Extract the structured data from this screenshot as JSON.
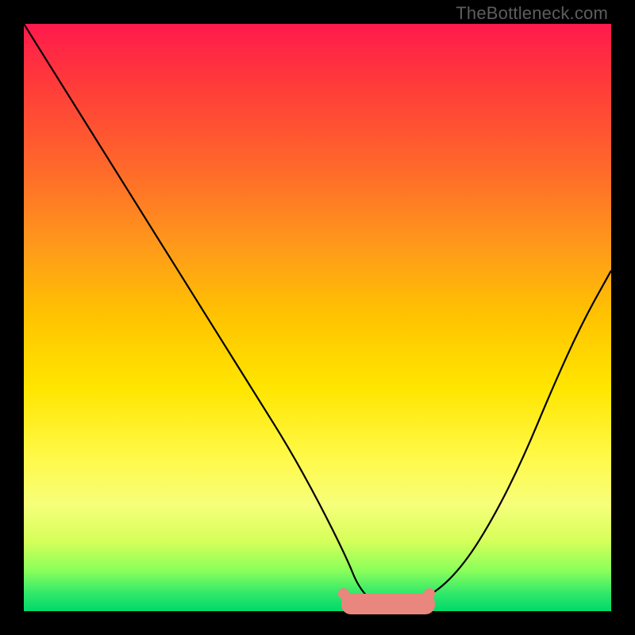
{
  "watermark": "TheBottleneck.com",
  "chart_data": {
    "type": "line",
    "title": "",
    "xlabel": "",
    "ylabel": "",
    "xlim": [
      0,
      100
    ],
    "ylim": [
      0,
      100
    ],
    "grid": false,
    "legend": false,
    "background_gradient": {
      "direction": "vertical",
      "stops": [
        {
          "pos": 0.0,
          "color": "#ff1a4d"
        },
        {
          "pos": 0.5,
          "color": "#ffc400"
        },
        {
          "pos": 0.82,
          "color": "#f6ff7a"
        },
        {
          "pos": 1.0,
          "color": "#00d96a"
        }
      ]
    },
    "series": [
      {
        "name": "bottleneck-curve",
        "color": "#000000",
        "x": [
          0,
          5,
          10,
          15,
          20,
          25,
          30,
          35,
          40,
          45,
          50,
          55,
          57,
          60,
          63,
          65,
          70,
          75,
          80,
          85,
          90,
          95,
          100
        ],
        "y": [
          100,
          92,
          84,
          76,
          68,
          60,
          52,
          44,
          36,
          28,
          19,
          9,
          4,
          1,
          0,
          1,
          3,
          8,
          16,
          26,
          38,
          49,
          58
        ]
      }
    ],
    "annotations": [
      {
        "name": "optimal-band",
        "type": "rect",
        "color": "#e9867d",
        "x_range": [
          54,
          70
        ],
        "y_range": [
          0,
          3
        ]
      },
      {
        "name": "optimal-dot-left",
        "type": "dot",
        "color": "#e9867d",
        "x": 54.5,
        "y": 3
      },
      {
        "name": "optimal-dot-right",
        "type": "dot",
        "color": "#e9867d",
        "x": 69,
        "y": 3
      }
    ]
  }
}
